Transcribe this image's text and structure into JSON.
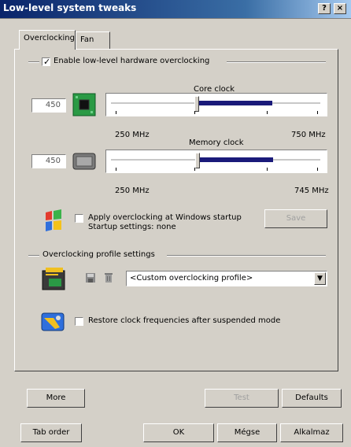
{
  "window": {
    "title": "Low-level system tweaks",
    "help_button": "?",
    "close_button": "×"
  },
  "tabs": [
    {
      "label": "Overclocking",
      "active": true
    },
    {
      "label": "Fan",
      "active": false
    }
  ],
  "overclocking": {
    "enable_label": "Enable low-level hardware overclocking",
    "enable_checked": true,
    "core_clock": {
      "title": "Core clock",
      "value": "450",
      "min_label": "250 MHz",
      "max_label": "750 MHz",
      "min": 250,
      "max": 750,
      "current": 450,
      "icon": "gpu-chip-icon"
    },
    "memory_clock": {
      "title": "Memory clock",
      "value": "450",
      "min_label": "250 MHz",
      "max_label": "745 MHz",
      "min": 250,
      "max": 745,
      "current": 450,
      "icon": "memory-chip-icon"
    },
    "startup": {
      "apply_label": "Apply overclocking at Windows startup",
      "apply_checked": false,
      "settings_text": "Startup settings: none",
      "save_label": "Save",
      "icon": "windows-flag-icon"
    },
    "profile": {
      "group_title": "Overclocking profile settings",
      "selected": "<Custom overclocking profile>",
      "icon": "profile-folder-icon"
    },
    "restore": {
      "label": "Restore clock frequencies after suspended mode",
      "checked": false,
      "icon": "suspend-tools-icon"
    },
    "buttons": {
      "more": "More",
      "test": "Test",
      "defaults": "Defaults"
    }
  },
  "footer": {
    "tab_order": "Tab order",
    "ok": "OK",
    "cancel": "Mégse",
    "apply": "Alkalmaz"
  },
  "colors": {
    "titlebar": "#0a246a",
    "slider_fill": "#1a1a7a",
    "gpu_icon": "#1f8f3a"
  }
}
